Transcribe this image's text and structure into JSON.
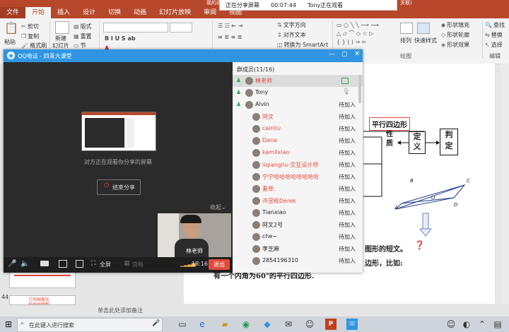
{
  "ppt": {
    "title_fragment": "我的近…",
    "title_right": "关联)",
    "tabs": [
      "文件",
      "开始",
      "插入",
      "设计",
      "切换",
      "动画",
      "幻灯片放映",
      "审阅",
      "视图"
    ],
    "clipboard": {
      "paste": "粘贴",
      "cut": "剪切",
      "copy": "复制",
      "format_painter": "格式刷"
    },
    "slides_group": {
      "new_slide": "新建\n幻灯片",
      "layout": "版式",
      "reset": "重置",
      "section": "节"
    },
    "paragraph": {
      "text_direction": "文字方向",
      "align_text": "对齐文本",
      "convert_smartart": "转换为 SmartArt"
    },
    "drawing": {
      "arrange": "排列",
      "quick_styles": "快速样式",
      "shape_fill": "形状填充",
      "shape_outline": "形状轮廓",
      "shape_effects": "形状效果",
      "group_label": "绘图"
    },
    "editing": {
      "find": "查找",
      "replace": "替换",
      "select": "选择",
      "group_label": "编辑"
    },
    "thumb_number": "44",
    "thumb_text": "几何画板比\n任画画图板\n的基本使用",
    "notes_placeholder": "单击此处添加备注",
    "slide": {
      "box_parallelogram": "平行四边形",
      "label_property": "性\n质",
      "box_define": "定\n义",
      "box_judge": "判\n定",
      "text_line1": "图形的短文。",
      "text_line2": "边形，比如:",
      "text_line3": "有一个内角为60°的平行四边形.",
      "question_mark": "❓",
      "point_labels": [
        "A",
        "B",
        "C",
        "D",
        "O"
      ]
    }
  },
  "share_banner": {
    "status": "正在分享屏幕",
    "time": "00:07:44",
    "viewer": "Tony正在观看"
  },
  "qq": {
    "title": "QQ电话 - 四青大课堂",
    "viewing_text": "对方正在观看你分享的屏幕",
    "end_share_label": "结束分享",
    "collapse_label": "收起",
    "camera_name": "林老师",
    "controls": {
      "fullscreen": "全屏",
      "gallery": "宫格",
      "time": "18:16",
      "exit": "退出"
    },
    "member_header": "群成员(11/16)",
    "members": [
      {
        "name": "林老师",
        "status": "",
        "color": "#e24a3b",
        "selected": true
      },
      {
        "name": "Tony",
        "status": "",
        "color": "#222222",
        "selected": false
      },
      {
        "name": "Alvin",
        "status": "待加入",
        "color": "#222222",
        "selected": false
      },
      {
        "name": "阿文",
        "status": "待加入",
        "color": "#e24a3b",
        "selected": false
      },
      {
        "name": "cainliu",
        "status": "待加入",
        "color": "#e24a3b",
        "selected": false
      },
      {
        "name": "Dana",
        "status": "待加入",
        "color": "#e24a3b",
        "selected": false
      },
      {
        "name": "kamilxiao",
        "status": "待加入",
        "color": "#e24a3b",
        "selected": false
      },
      {
        "name": "liqiangliu-交互设计师",
        "status": "待加入",
        "color": "#e24a3b",
        "selected": false
      },
      {
        "name": "宁宁哈哈哈哈哈哈哈哈",
        "status": "待加入",
        "color": "#e24a3b",
        "selected": false
      },
      {
        "name": "素草.",
        "status": "待加入",
        "color": "#e24a3b",
        "selected": false
      },
      {
        "name": "许昱栋Derek",
        "status": "待加入",
        "color": "#e24a3b",
        "selected": false
      },
      {
        "name": "Tianxiao",
        "status": "待加入",
        "color": "#222222",
        "selected": false
      },
      {
        "name": "阿文2号",
        "status": "待加入",
        "color": "#222222",
        "selected": false
      },
      {
        "name": "che~",
        "status": "待加入",
        "color": "#222222",
        "selected": false
      },
      {
        "name": "李芝麻",
        "status": "待加入",
        "color": "#222222",
        "selected": false
      },
      {
        "name": "2854196310",
        "status": "待加入",
        "color": "#222222",
        "selected": false
      }
    ]
  },
  "taskbar": {
    "search_placeholder": "在此键入进行搜索"
  }
}
